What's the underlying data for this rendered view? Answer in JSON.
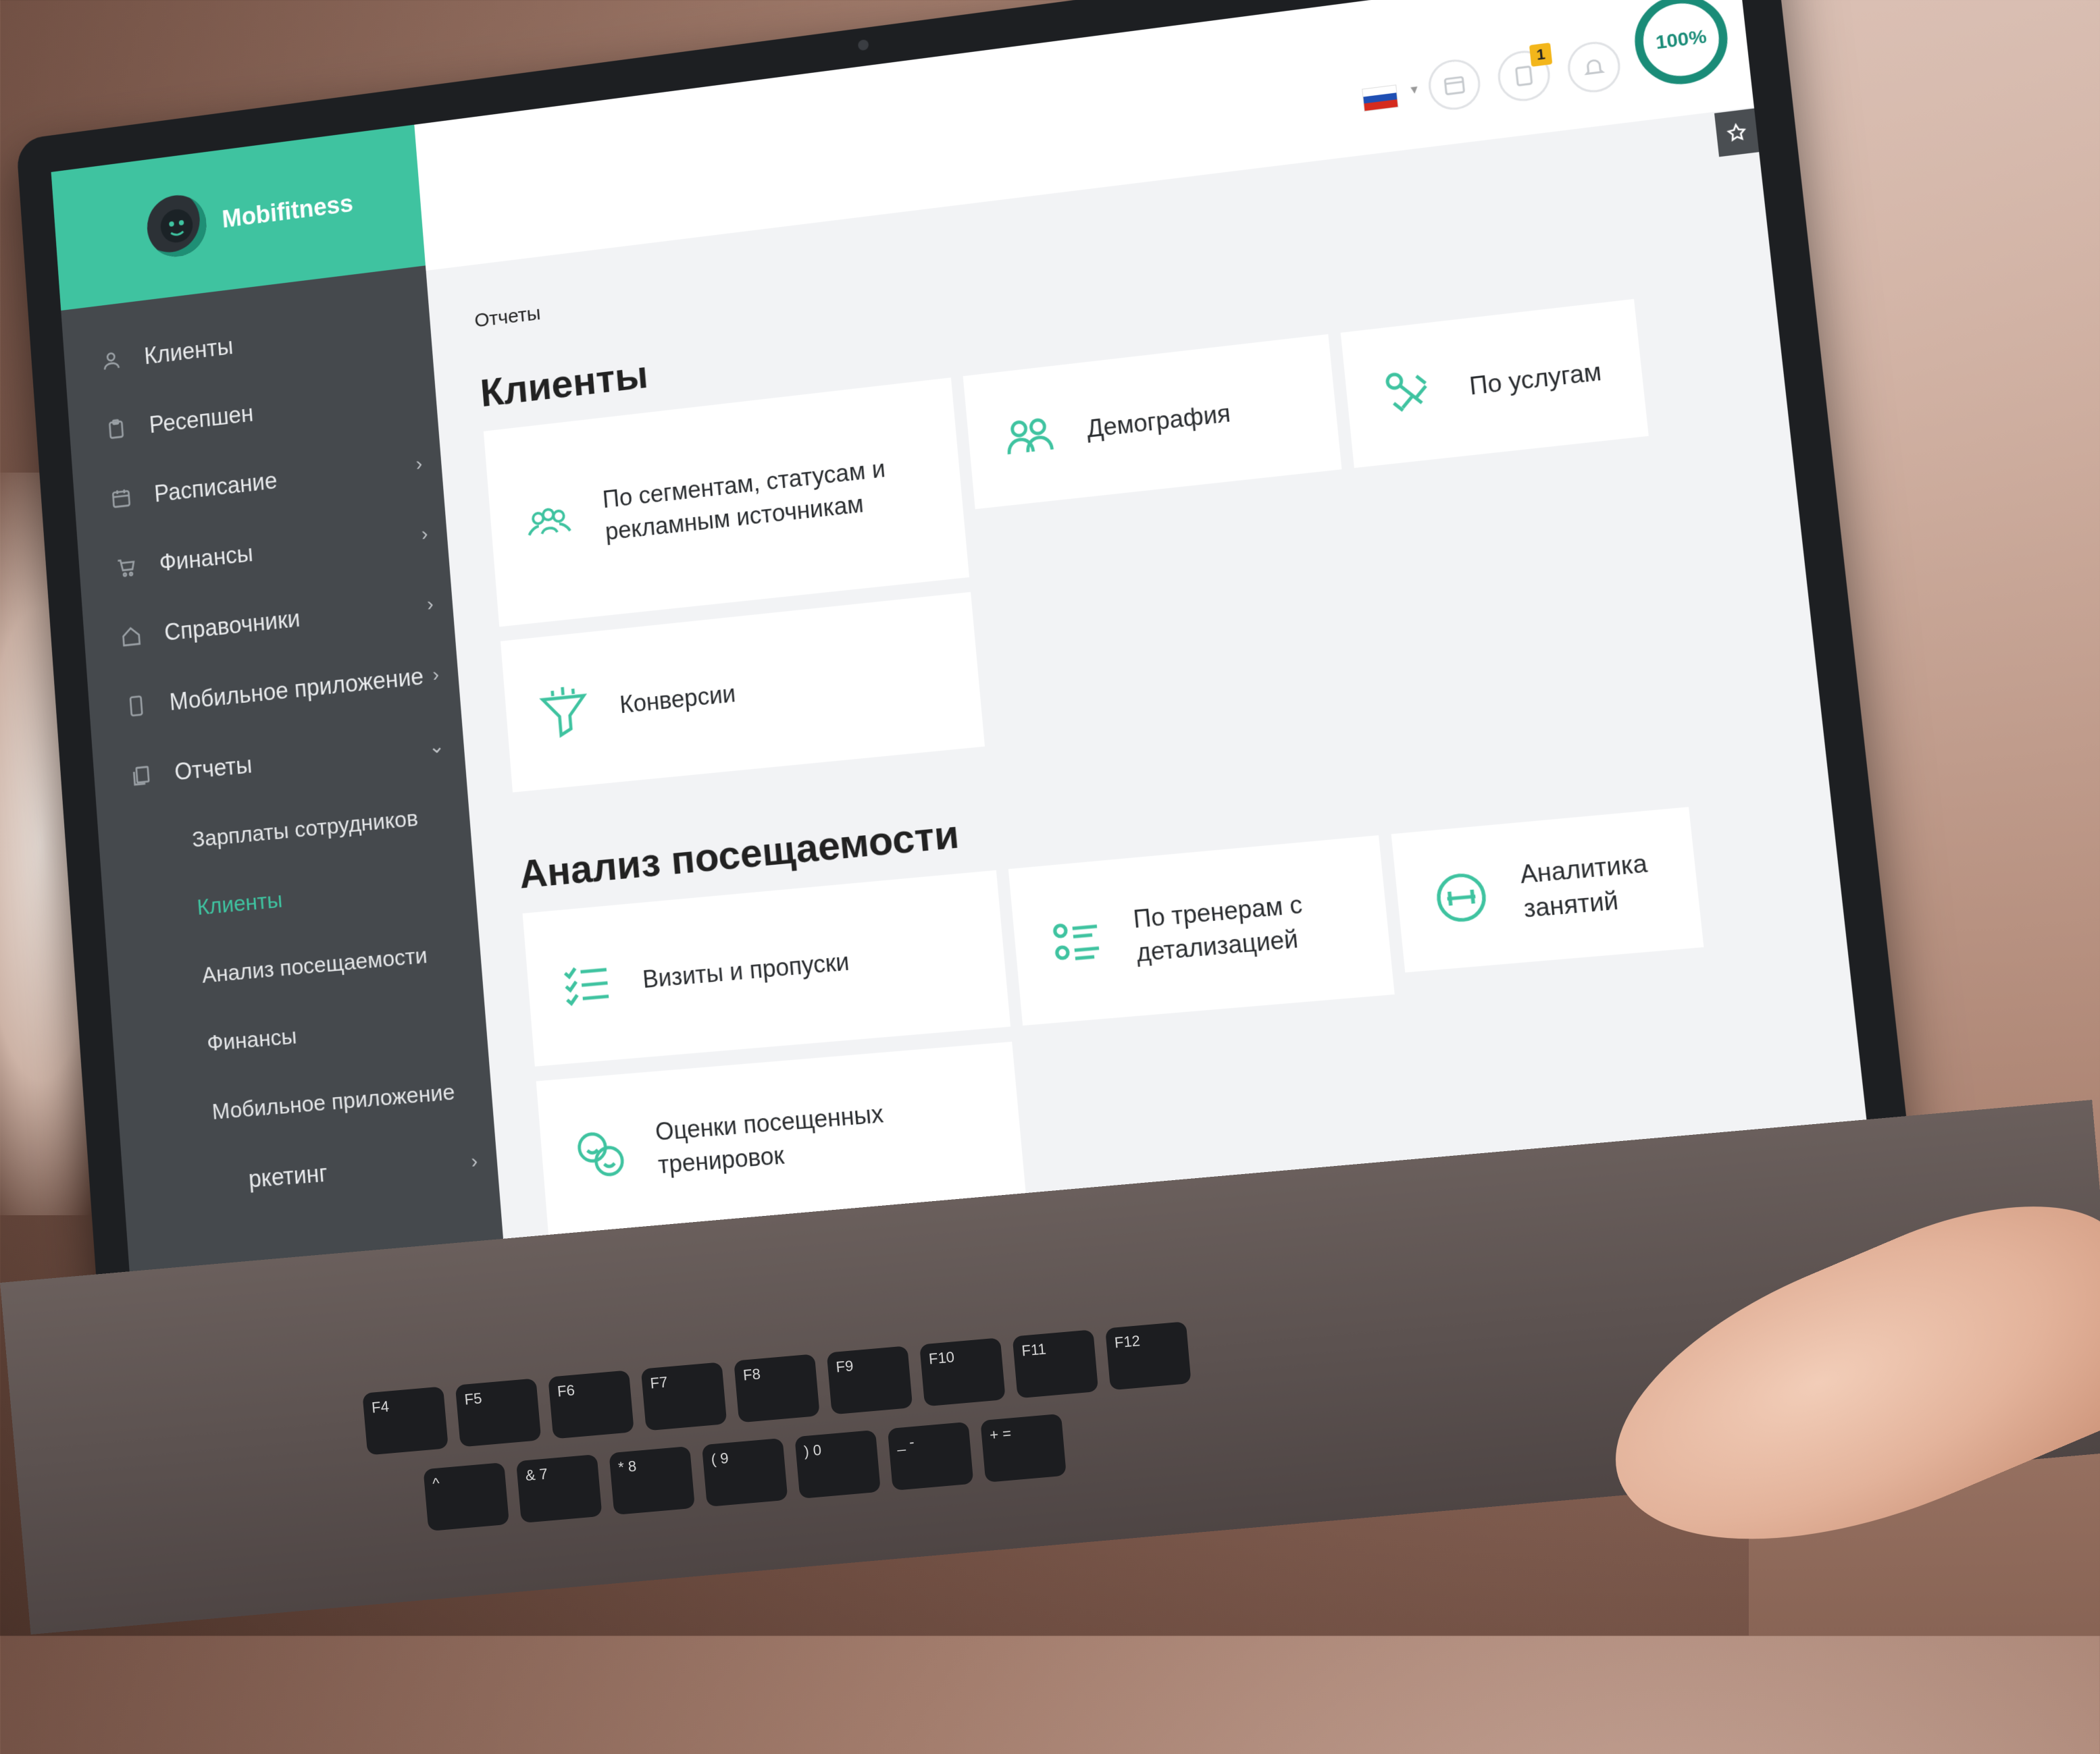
{
  "app": {
    "brand_name": "Mobifitness"
  },
  "sidebar": {
    "items": [
      {
        "label": "Клиенты",
        "icon": "user-icon",
        "has_submenu": false
      },
      {
        "label": "Ресепшен",
        "icon": "clipboard-icon",
        "has_submenu": false
      },
      {
        "label": "Расписание",
        "icon": "calendar-icon",
        "has_submenu": true
      },
      {
        "label": "Финансы",
        "icon": "cart-icon",
        "has_submenu": true
      },
      {
        "label": "Справочники",
        "icon": "home-icon",
        "has_submenu": true
      },
      {
        "label": "Мобильное приложение",
        "icon": "phone-icon",
        "has_submenu": true
      },
      {
        "label": "Отчеты",
        "icon": "documents-icon",
        "has_submenu": true,
        "expanded": true
      }
    ],
    "reports_submenu": [
      {
        "label": "Зарплаты сотрудников",
        "active": false
      },
      {
        "label": "Клиенты",
        "active": true
      },
      {
        "label": "Анализ посещаемости",
        "active": false
      },
      {
        "label": "Финансы",
        "active": false
      },
      {
        "label": "Мобильное приложение",
        "active": false
      }
    ],
    "partial_item": {
      "label": "ркетинг",
      "has_submenu": true
    },
    "collapse_glyph": "‹"
  },
  "topbar": {
    "language_flag": "ru",
    "notification_badge": "1",
    "progress_label": "100%",
    "progress_value": 1.0
  },
  "main": {
    "breadcrumb": "Отчеты",
    "sections": [
      {
        "title": "Клиенты",
        "cards": [
          {
            "label": "По сегментам, статусам и рекламным источникам",
            "icon": "people-group-icon"
          },
          {
            "label": "Демография",
            "icon": "two-people-icon"
          },
          {
            "label": "По услугам",
            "icon": "dumbbell-tools-icon"
          },
          {
            "label": "Конверсии",
            "icon": "funnel-icon"
          }
        ]
      },
      {
        "title": "Анализ посещаемости",
        "cards": [
          {
            "label": "Визиты и пропуски",
            "icon": "checklist-icon"
          },
          {
            "label": "По тренерам с детализацией",
            "icon": "trainer-list-icon"
          },
          {
            "label": "Аналитика занятий",
            "icon": "dumbbell-circle-icon"
          },
          {
            "label": "Оценки посещенных тренировок",
            "icon": "smiley-faces-icon"
          }
        ]
      }
    ]
  },
  "colors": {
    "accent": "#3fc3a0",
    "sidebar_bg": "#45494d",
    "progress": "#1a8c78",
    "badge": "#f3b61b"
  }
}
